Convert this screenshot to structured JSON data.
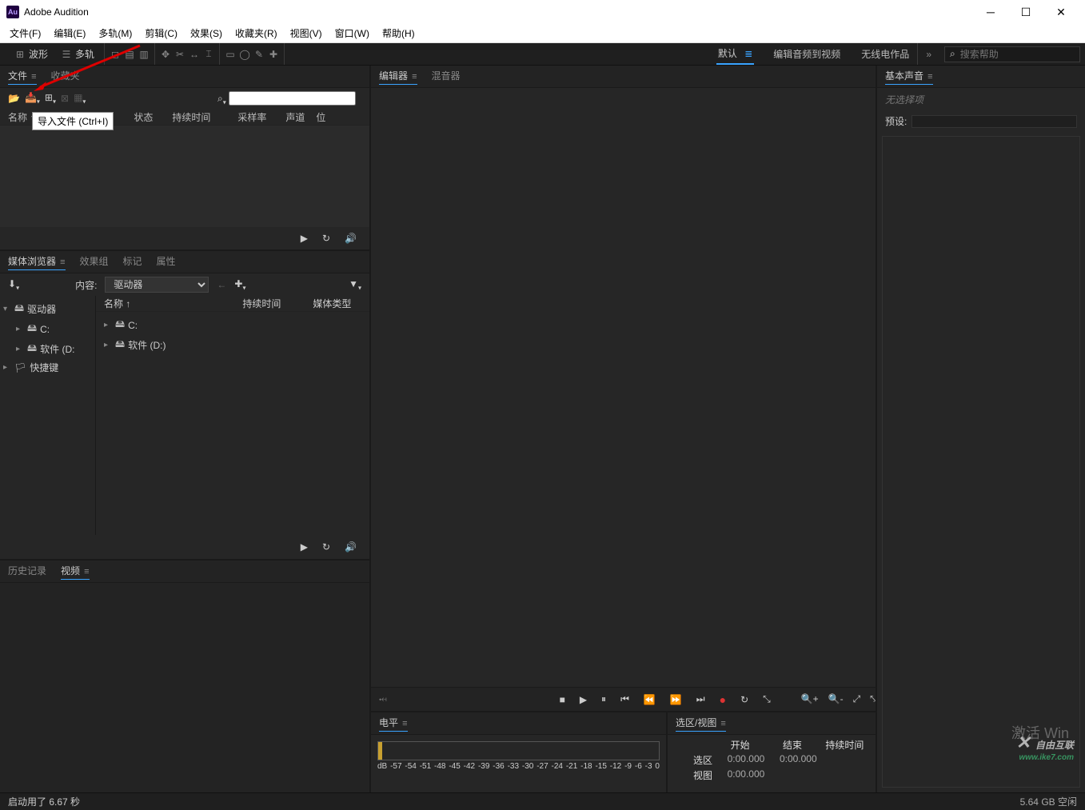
{
  "window": {
    "title": "Adobe Audition",
    "logo_text": "Au"
  },
  "menu": [
    "文件(F)",
    "编辑(E)",
    "多轨(M)",
    "剪辑(C)",
    "效果(S)",
    "收藏夹(R)",
    "视图(V)",
    "窗口(W)",
    "帮助(H)"
  ],
  "toolbar": {
    "waveform": "波形",
    "multitrack": "多轨"
  },
  "workspaces": {
    "default": "默认",
    "edit_to_video": "编辑音频到视频",
    "radio": "无线电作品"
  },
  "search_help_placeholder": "搜索帮助",
  "files_panel": {
    "tab_files": "文件",
    "tab_favorites": "收藏夹",
    "import_tooltip": "导入文件 (Ctrl+I)",
    "headers": {
      "name": "名称 ↑",
      "status": "状态",
      "duration": "持续时间",
      "sample_rate": "采样率",
      "channels": "声道",
      "bit": "位"
    },
    "search_placeholder": ""
  },
  "media_panel": {
    "tab_media": "媒体浏览器",
    "tab_fxrack": "效果组",
    "tab_markers": "标记",
    "tab_props": "属性",
    "content_label": "内容:",
    "content_value": "驱动器",
    "headers": {
      "name": "名称 ↑",
      "duration": "持续时间",
      "media_type": "媒体类型"
    },
    "tree_left": [
      {
        "label": "驱动器",
        "indent": 0,
        "expand": "▾",
        "icon": "🖴"
      },
      {
        "label": "C:",
        "indent": 1,
        "expand": "▸",
        "icon": "🖴"
      },
      {
        "label": "软件 (D:",
        "indent": 1,
        "expand": "▸",
        "icon": "🖴"
      },
      {
        "label": "快捷键",
        "indent": 0,
        "expand": "▸",
        "icon": "🏳"
      }
    ],
    "tree_right": [
      {
        "label": "C:",
        "icon": "🖴"
      },
      {
        "label": "软件 (D:)",
        "icon": "🖴"
      }
    ]
  },
  "history_panel": {
    "tab_history": "历史记录",
    "tab_video": "视频"
  },
  "editor_panel": {
    "tab_editor": "编辑器",
    "tab_mixer": "混音器"
  },
  "levels_panel": {
    "title": "电平",
    "db_label": "dB",
    "scale": [
      "-57",
      "-54",
      "-51",
      "-48",
      "-45",
      "-42",
      "-39",
      "-36",
      "-33",
      "-30",
      "-27",
      "-24",
      "-21",
      "-18",
      "-15",
      "-12",
      "-9",
      "-6",
      "-3",
      "0"
    ]
  },
  "selview_panel": {
    "title": "选区/视图",
    "headers": {
      "start": "开始",
      "end": "结束",
      "duration": "持续时间"
    },
    "sel_label": "选区",
    "sel_start": "0:00.000",
    "sel_end": "0:00.000",
    "view_label": "视图",
    "view_start": "0:00.000"
  },
  "ess_panel": {
    "title": "基本声音",
    "no_selection": "无选择项",
    "preset_label": "预设:"
  },
  "status": {
    "start_time": "启动用了 6.67 秒",
    "disk": "5.64 GB 空闲"
  },
  "activate_text": "激活 Win",
  "watermark": {
    "main": "自由互联",
    "sub": "www.ike7.com"
  }
}
